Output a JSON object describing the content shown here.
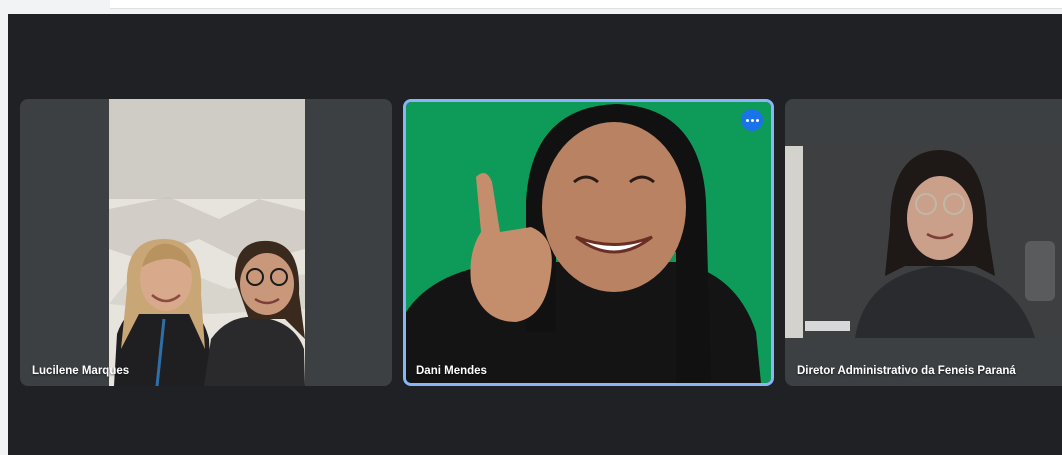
{
  "meeting": {
    "participants": [
      {
        "name": "Lucilene Marques",
        "speaking": false
      },
      {
        "name": "Dani Mendes",
        "speaking": true
      },
      {
        "name": "Diretor Administrativo da Feneis Paraná",
        "speaking": false
      }
    ]
  },
  "icons": {
    "more_options": "more-horiz-icon"
  },
  "colors": {
    "stage_background": "#202124",
    "tile_background": "#3c4043",
    "active_speaker_border": "#8ab4f8",
    "more_button": "#1a73e8",
    "green_screen": "#0e9a58"
  }
}
